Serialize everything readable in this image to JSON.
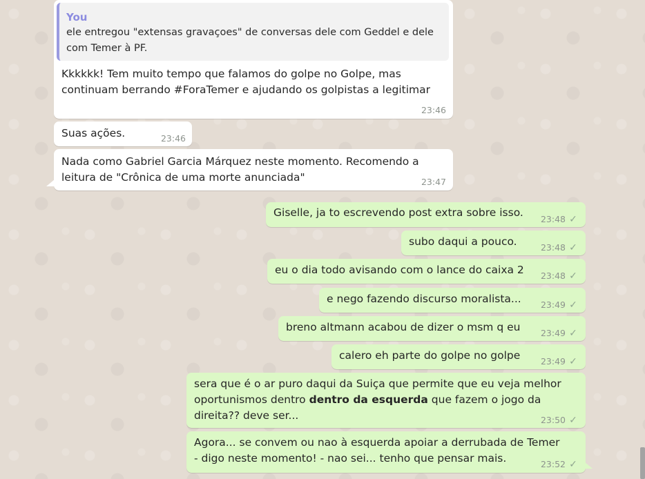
{
  "chat": {
    "messages": [
      {
        "id": "m1",
        "direction": "incoming",
        "quote": {
          "author": "You",
          "text": "ele entregou \"extensas gravaçoes\" de conversas dele com Geddel e dele com Temer à PF."
        },
        "text": "Kkkkkk! Tem muito tempo que falamos do golpe no Golpe, mas continuam berrando #ForaTemer e ajudando os golpistas a legitimar",
        "time": "23:46"
      },
      {
        "id": "m2",
        "direction": "incoming",
        "text": "Suas ações.",
        "time": "23:46"
      },
      {
        "id": "m3",
        "direction": "incoming",
        "text": "Nada como Gabriel Garcia Márquez neste momento. Recomendo a leitura de \"Crônica de uma morte anunciada\"",
        "time": "23:47"
      },
      {
        "id": "m4",
        "direction": "outgoing",
        "text": "Giselle, ja to escrevendo post extra sobre isso.",
        "time": "23:48",
        "status_icon": "single-check-icon"
      },
      {
        "id": "m5",
        "direction": "outgoing",
        "text": "subo daqui a pouco.",
        "time": "23:48",
        "status_icon": "single-check-icon"
      },
      {
        "id": "m6",
        "direction": "outgoing",
        "text": "eu o dia todo avisando com o lance do caixa 2",
        "time": "23:48",
        "status_icon": "single-check-icon"
      },
      {
        "id": "m7",
        "direction": "outgoing",
        "text": "e nego fazendo discurso moralista...",
        "time": "23:49",
        "status_icon": "single-check-icon"
      },
      {
        "id": "m8",
        "direction": "outgoing",
        "text": "breno altmann acabou de dizer o msm q eu",
        "time": "23:49",
        "status_icon": "single-check-icon"
      },
      {
        "id": "m9",
        "direction": "outgoing",
        "text": "calero eh parte do golpe no golpe",
        "time": "23:49",
        "status_icon": "single-check-icon"
      },
      {
        "id": "m10",
        "direction": "outgoing",
        "text_before_bold": "sera que é o ar puro daqui da Suiça que permite que eu veja melhor oportunismos dentro ",
        "text_bold": "dentro da esquerda",
        "text_after_bold": " que fazem o jogo da direita?? deve ser...",
        "time": "23:50",
        "status_icon": "single-check-icon"
      },
      {
        "id": "m11",
        "direction": "outgoing",
        "text": "Agora... se convem ou nao à esquerda apoiar a derrubada de Temer - digo neste momento! - nao sei... tenho que pensar mais.",
        "time": "23:52",
        "status_icon": "single-check-icon"
      }
    ]
  },
  "colors": {
    "chat_background": "#e4dcd3",
    "incoming_bubble": "#ffffff",
    "outgoing_bubble": "#dcf8c6",
    "quote_accent": "#9a9ae0",
    "timestamp": "#8d938d"
  }
}
